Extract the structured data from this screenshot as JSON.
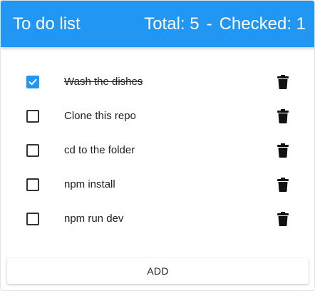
{
  "header": {
    "title": "To do list",
    "total_text": "Total: 5",
    "separator": "-",
    "checked_text": "Checked: 1"
  },
  "todos": [
    {
      "label": "Wash the dishes",
      "checked": true
    },
    {
      "label": "Clone this repo",
      "checked": false
    },
    {
      "label": "cd to the folder",
      "checked": false
    },
    {
      "label": "npm install",
      "checked": false
    },
    {
      "label": "npm run dev",
      "checked": false
    }
  ],
  "icons": {
    "checkbox": "checkbox-icon",
    "delete": "trash-icon"
  },
  "footer": {
    "add_label": "ADD"
  },
  "colors": {
    "accent": "#2196f3",
    "text": "#222222"
  }
}
